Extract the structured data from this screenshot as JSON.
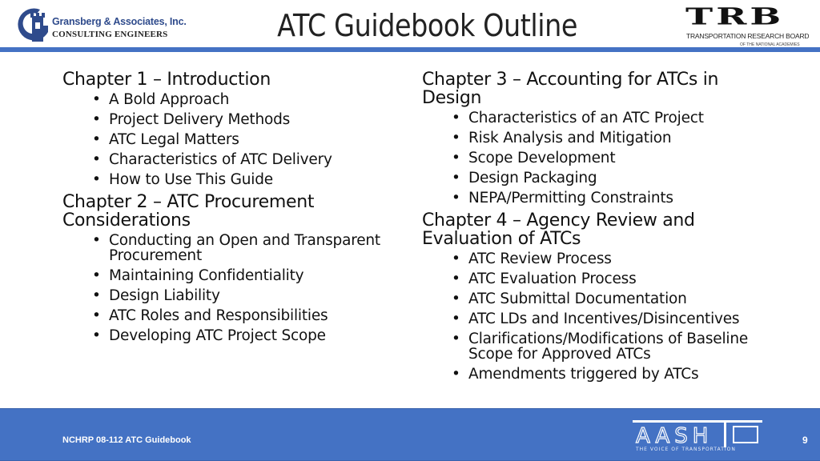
{
  "header": {
    "title": "ATC Guidebook Outline",
    "left_logo": {
      "name": "Gransberg & Associates, Inc.",
      "subtitle": "CONSULTING ENGINEERS"
    },
    "right_logo": {
      "name": "TRB",
      "subtitle": "TRANSPORTATION RESEARCH BOARD",
      "subtitle2": "OF THE NATIONAL ACADEMIES"
    }
  },
  "columns": [
    {
      "chapters": [
        {
          "title": "Chapter 1 – Introduction",
          "items": [
            "A Bold Approach",
            "Project Delivery Methods",
            "ATC Legal Matters",
            "Characteristics of ATC Delivery",
            "How to Use This Guide"
          ]
        },
        {
          "title": "Chapter 2 – ATC Procurement Considerations",
          "items": [
            "Conducting an Open and Transparent Procurement",
            "Maintaining Confidentiality",
            "Design Liability",
            "ATC Roles and Responsibilities",
            "Developing ATC Project Scope"
          ]
        }
      ]
    },
    {
      "chapters": [
        {
          "title": "Chapter 3 – Accounting for ATCs in Design",
          "items": [
            "Characteristics of an ATC Project",
            "Risk Analysis and Mitigation",
            "Scope Development",
            "Design Packaging",
            "NEPA/Permitting Constraints"
          ]
        },
        {
          "title": "Chapter 4 – Agency Review and Evaluation of ATCs",
          "items": [
            "ATC Review Process",
            "ATC Evaluation Process",
            "ATC Submittal Documentation",
            "ATC LDs and Incentives/Disincentives",
            "Clarifications/Modifications of Baseline Scope for Approved ATCs",
            "Amendments triggered by ATCs"
          ]
        }
      ]
    }
  ],
  "footer": {
    "text": "NCHRP 08-112 ATC Guidebook",
    "page_number": "9",
    "logo": {
      "name": "AASHTO",
      "tagline": "THE VOICE OF TRANSPORTATION"
    }
  },
  "bullet": "•",
  "colors": {
    "accent": "#4472c4",
    "logo_blue": "#2f4b8c"
  }
}
